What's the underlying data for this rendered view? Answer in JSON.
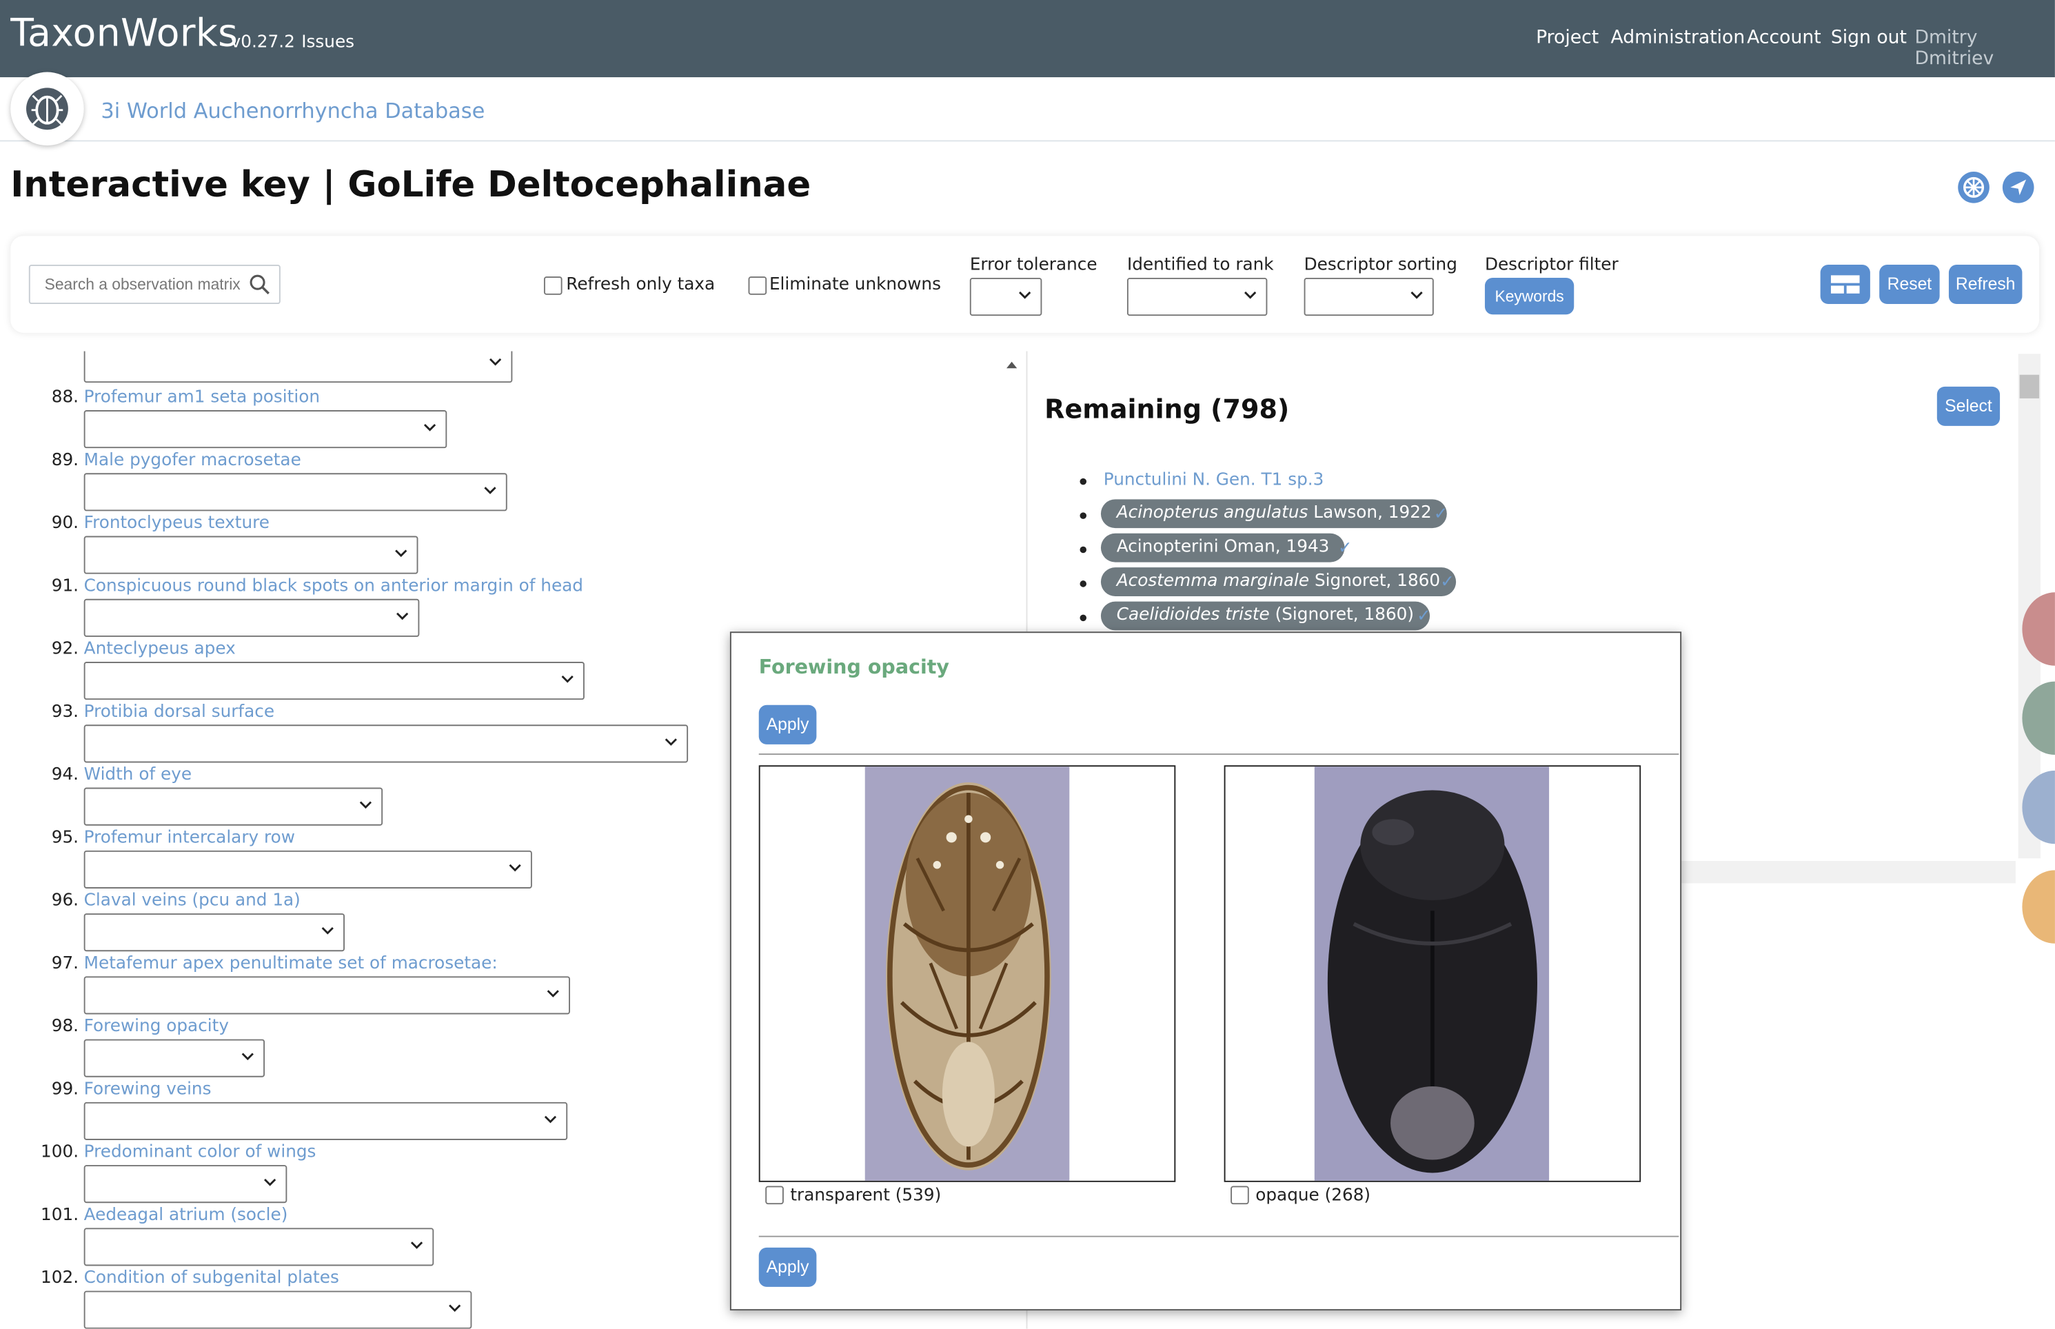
{
  "app": {
    "brand": "TaxonWorks",
    "version": "v0.27.2",
    "issues": "Issues"
  },
  "nav": {
    "project": "Project",
    "administration": "Administration",
    "account": "Account",
    "sign_out": "Sign out",
    "user": "Dmitry Dmitriev"
  },
  "project_name": "3i World Auchenorrhyncha Database",
  "page_title": "Interactive key | GoLife Deltocephalinae",
  "filters": {
    "search_placeholder": "Search a observation matrix",
    "refresh_only_taxa": "Refresh only taxa",
    "eliminate_unknowns": "Eliminate unknowns",
    "error_tolerance": "Error tolerance",
    "identified_to_rank": "Identified to rank",
    "descriptor_sorting": "Descriptor sorting",
    "descriptor_filter": "Descriptor filter",
    "keywords": "Keywords",
    "reset": "Reset",
    "refresh": "Refresh"
  },
  "descriptors": [
    {
      "num": "88.",
      "name": "Profemur am1 seta position"
    },
    {
      "num": "89.",
      "name": "Male pygofer macrosetae"
    },
    {
      "num": "90.",
      "name": "Frontoclypeus texture"
    },
    {
      "num": "91.",
      "name": "Conspicuous round black spots on anterior margin of head"
    },
    {
      "num": "92.",
      "name": "Anteclypeus apex"
    },
    {
      "num": "93.",
      "name": "Protibia dorsal surface"
    },
    {
      "num": "94.",
      "name": "Width of eye"
    },
    {
      "num": "95.",
      "name": "Profemur intercalary row"
    },
    {
      "num": "96.",
      "name": "Claval veins (pcu and 1a)"
    },
    {
      "num": "97.",
      "name": "Metafemur apex penultimate set of macrosetae:"
    },
    {
      "num": "98.",
      "name": "Forewing opacity"
    },
    {
      "num": "99.",
      "name": "Forewing veins"
    },
    {
      "num": "100.",
      "name": "Predominant color of wings"
    },
    {
      "num": "101.",
      "name": "Aedeagal atrium (socle)"
    },
    {
      "num": "102.",
      "name": "Condition of subgenital plates"
    }
  ],
  "remaining": {
    "title": "Remaining (798)",
    "select": "Select",
    "taxa": [
      {
        "italic": "",
        "rest": "Punctulini N. Gen. T1 sp.3"
      },
      {
        "italic": "Acinopterus angulatus",
        "rest": " Lawson, 1922"
      },
      {
        "italic": "",
        "rest": "Acinopterini Oman, 1943"
      },
      {
        "italic": "Acostemma marginale",
        "rest": " Signoret, 1860"
      },
      {
        "italic": "Caelidioides triste",
        "rest": " (Signoret, 1860)"
      }
    ],
    "check": "✓"
  },
  "modal": {
    "title": "Forewing opacity",
    "apply": "Apply",
    "options": [
      {
        "label": "transparent (539)"
      },
      {
        "label": "opaque (268)"
      }
    ]
  },
  "colors": {
    "topbar": "#4a5b66",
    "accent": "#5b8fd0",
    "link": "#6e9ccf",
    "modal_title": "#6aa97d",
    "pill": "#6f7a80"
  }
}
